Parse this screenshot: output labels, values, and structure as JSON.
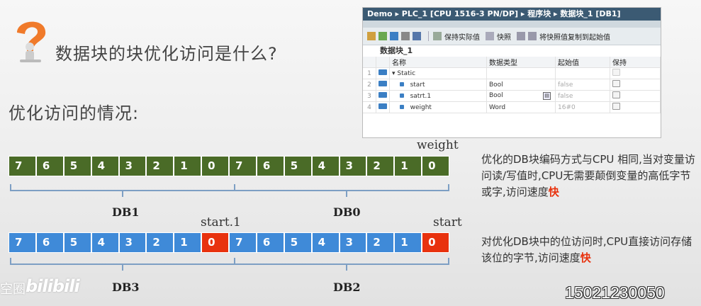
{
  "slide": {
    "title": "数据块的块优化访问是什么?",
    "subtitle": "优化访问的情况:",
    "watermark_text": "空圈",
    "watermark_logo": "bilibili",
    "phone": "15021230050"
  },
  "colors": {
    "green": "#4a6b27",
    "blue": "#3f8ad8",
    "red": "#e8320e",
    "bracket": "#7d9fc4"
  },
  "tia": {
    "path": "Demo ▸ PLC_1 [CPU 1516-3 PN/DP] ▸ 程序块 ▸ 数据块_1 [DB1]",
    "toolbar": {
      "keep_actual": "保持实际值",
      "snapshot": "快照",
      "copy_snapshot": "将快照值复制到起始值"
    },
    "block_name": "数据块_1",
    "columns": {
      "name": "名称",
      "type": "数据类型",
      "start": "起始值",
      "retain": "保持"
    },
    "rows": [
      {
        "num": "1",
        "name": "Static",
        "type": "",
        "start": ""
      },
      {
        "num": "2",
        "name": "start",
        "type": "Bool",
        "start": "false"
      },
      {
        "num": "3",
        "name": "satrt.1",
        "type": "Bool",
        "start": "false"
      },
      {
        "num": "4",
        "name": "weight",
        "type": "Word",
        "start": "16#0"
      }
    ]
  },
  "row_top": {
    "bits": [
      "7",
      "6",
      "5",
      "4",
      "3",
      "2",
      "1",
      "0",
      "7",
      "6",
      "5",
      "4",
      "3",
      "2",
      "1",
      "0"
    ],
    "field_label": "weight",
    "db_left": "DB1",
    "db_right": "DB0"
  },
  "row_bottom": {
    "bits": [
      "7",
      "6",
      "5",
      "4",
      "3",
      "2",
      "1",
      "0",
      "7",
      "6",
      "5",
      "4",
      "3",
      "2",
      "1",
      "0"
    ],
    "red_indices": [
      7,
      15
    ],
    "label_a": "start.1",
    "label_b": "start",
    "db_left": "DB3",
    "db_right": "DB2"
  },
  "notes": {
    "p1": "优化的DB块编码方式与CPU 相同,当对变量访问读/写值时,CPU无需要颠倒变量的高低字节或字,访问速度",
    "p1_hl": "快",
    "p2": "对优化DB块中的位访问时,CPU直接访问存储该位的字节,访问速度",
    "p2_hl": "快"
  }
}
